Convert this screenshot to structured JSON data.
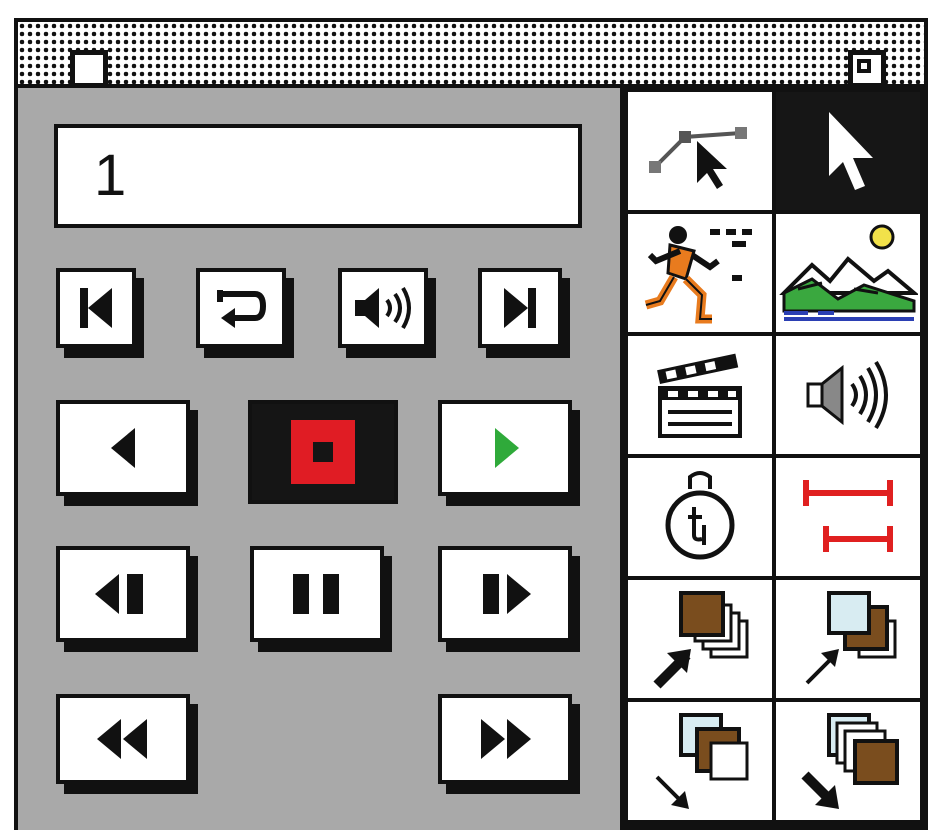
{
  "window": {
    "title": ""
  },
  "frame_counter": {
    "value": "1"
  },
  "transport": {
    "buttons": [
      "go-to-start",
      "loop",
      "volume",
      "go-to-end",
      "step-backward",
      "stop",
      "play-forward",
      "play-backward-slow",
      "pause",
      "play-forward-slow",
      "rewind",
      "fast-forward"
    ],
    "colors": {
      "stop": "#e01c24",
      "play": "#2faa3a"
    }
  },
  "tools": [
    "path-tool-icon",
    "arrow-tool-icon",
    "actor-icon",
    "background-scene-icon",
    "clapboard-icon",
    "sound-icon",
    "stopwatch-icon",
    "sync-interval-icon",
    "send-to-back-icon",
    "send-backward-icon",
    "bring-forward-icon",
    "bring-to-front-icon"
  ],
  "colors": {
    "panel": "#a9a9a9",
    "brown": "#7a4d1e",
    "light-blue": "#d8ecf2",
    "scene-green": "#3aa83f",
    "sun": "#f2e14a",
    "actor-orange": "#e87b1e",
    "interval-red": "#e02020"
  }
}
